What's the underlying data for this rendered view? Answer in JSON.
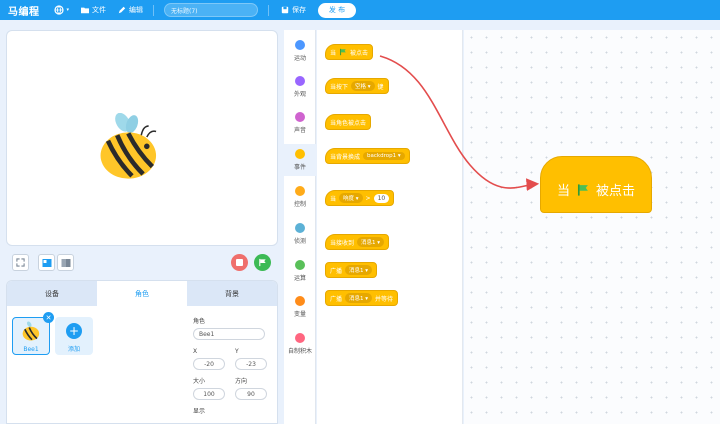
{
  "app": {
    "logo": "马编程",
    "menu_file": "文件",
    "menu_edit": "编辑",
    "project_title": "无标题(7)",
    "save_label": "保存",
    "publish_label": "发 布"
  },
  "sprite_panel": {
    "tabs": [
      "设备",
      "角色",
      "背景"
    ],
    "active_tab": "角色",
    "sprite_name": "Bee1",
    "add_label": "添加",
    "props": {
      "role_label": "角色",
      "role_value": "Bee1",
      "x_label": "X",
      "x_value": "-20",
      "y_label": "Y",
      "y_value": "-23",
      "size_label": "大小",
      "size_value": "100",
      "direction_label": "方向",
      "direction_value": "90",
      "show_label": "显示"
    }
  },
  "categories": [
    {
      "label": "运动",
      "color": "#4c97ff"
    },
    {
      "label": "外观",
      "color": "#9966ff"
    },
    {
      "label": "声音",
      "color": "#cf63cf"
    },
    {
      "label": "事件",
      "color": "#ffbf00"
    },
    {
      "label": "控制",
      "color": "#ffab19"
    },
    {
      "label": "侦测",
      "color": "#5cb1d6"
    },
    {
      "label": "运算",
      "color": "#59c059"
    },
    {
      "label": "变量",
      "color": "#ff8c1a"
    },
    {
      "label": "自制积木",
      "color": "#ff6680"
    }
  ],
  "palette": {
    "b1": {
      "pre": "当",
      "post": "被点击"
    },
    "b2": {
      "pre": "当按下",
      "key": "空格 ▾",
      "post": "键"
    },
    "b3": {
      "text": "当角色被点击"
    },
    "b4": {
      "pre": "当背景换成",
      "backdrop": "backdrop1 ▾"
    },
    "b5": {
      "pre": "当",
      "sensor": "响度 ▾",
      "op": ">",
      "value": "10"
    },
    "b6": {
      "pre": "当接收到",
      "msg": "消息1 ▾"
    },
    "b7": {
      "pre": "广播",
      "msg": "消息1 ▾"
    },
    "b8": {
      "pre": "广播",
      "msg": "消息1 ▾",
      "post": "并等待"
    }
  },
  "workspace": {
    "hat_pre": "当",
    "hat_post": "被点击"
  },
  "colors": {
    "brand": "#1e9df2",
    "events": "#ffbf00",
    "stop": "#ef6f6c",
    "go": "#3cba55",
    "arrow": "#e34d4d"
  }
}
